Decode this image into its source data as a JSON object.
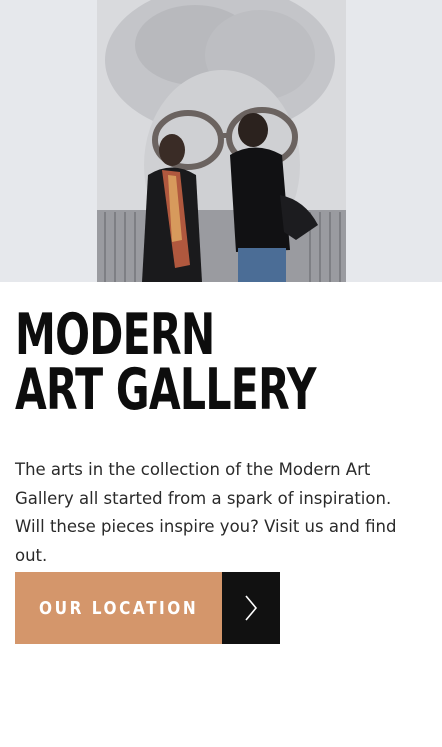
{
  "hero": {
    "image_name": "gallery-visitors-photo"
  },
  "heading": {
    "line1": "MODERN",
    "line2": "ART GALLERY"
  },
  "intro_text": "The arts in the collection of the Modern Art Gallery all started from a spark of inspiration. Will these pieces inspire you? Visit us and find out.",
  "cta": {
    "label": "OUR LOCATION",
    "icon": "chevron-right-icon"
  },
  "colors": {
    "accent": "#d4966b",
    "arrow_bg": "#111111",
    "text": "#0d0d0d"
  }
}
